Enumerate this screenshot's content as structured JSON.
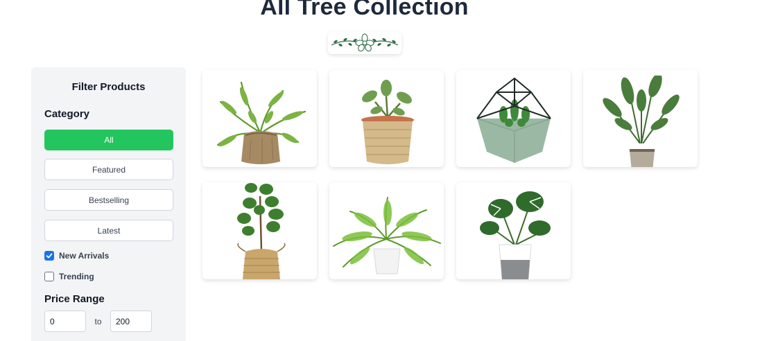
{
  "page": {
    "title": "All Tree Collection"
  },
  "sidebar": {
    "title": "Filter Products",
    "category_heading": "Category",
    "categories": [
      {
        "label": "All",
        "active": true
      },
      {
        "label": "Featured",
        "active": false
      },
      {
        "label": "Bestselling",
        "active": false
      },
      {
        "label": "Latest",
        "active": false
      }
    ],
    "checkboxes": [
      {
        "label": "New Arrivals",
        "checked": true
      },
      {
        "label": "Trending",
        "checked": false
      }
    ],
    "price_heading": "Price Range",
    "price_min": "0",
    "price_to": "to",
    "price_max": "200"
  },
  "products": [
    {
      "image": "birds-nest-fern-in-burlap-sack"
    },
    {
      "image": "jade-plant-in-woven-basket"
    },
    {
      "image": "succulents-in-geometric-terrarium"
    },
    {
      "image": "bird-of-paradise-in-striped-pot"
    },
    {
      "image": "fiddle-leaf-fig-in-seagrass-basket"
    },
    {
      "image": "boston-fern-in-white-pot"
    },
    {
      "image": "monstera-in-grey-white-pot"
    }
  ],
  "colors": {
    "accent": "#22c55e",
    "title": "#1e2a3b",
    "sidebar_bg": "#f3f4f6",
    "checkbox": "#1a73e8"
  }
}
